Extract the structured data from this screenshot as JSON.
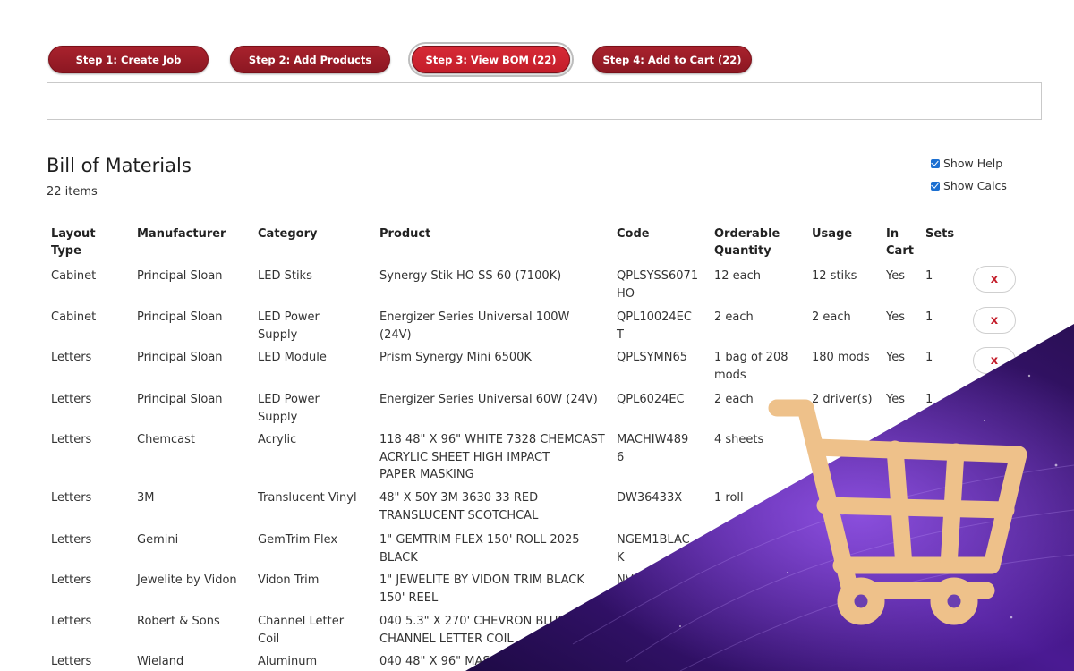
{
  "steps": [
    {
      "label": "Step 1: Create Job",
      "active": false
    },
    {
      "label": "Step 2: Add Products",
      "active": false
    },
    {
      "label": "Step 3: View BOM (22)",
      "active": true
    },
    {
      "label": "Step 4: Add to Cart (22)",
      "active": false
    }
  ],
  "bom": {
    "title": "Bill of Materials",
    "count": "22 items",
    "show_help": {
      "label": "Show Help",
      "checked": true
    },
    "show_calcs": {
      "label": "Show Calcs",
      "checked": true
    }
  },
  "table": {
    "headers": {
      "layout_type": [
        "Layout",
        "Type"
      ],
      "manufacturer": "Manufacturer",
      "category": "Category",
      "product": "Product",
      "code": "Code",
      "orderable_quantity": [
        "Orderable",
        "Quantity"
      ],
      "usage": "Usage",
      "in_cart": [
        "In",
        "Cart"
      ],
      "sets": "Sets"
    },
    "remove_label": "x",
    "rows": [
      {
        "layout": "Cabinet",
        "manufacturer": "Principal Sloan",
        "category": [
          "LED Stiks"
        ],
        "product": [
          "Synergy Stik HO SS 60 (7100K)"
        ],
        "code": [
          "QPLSYSS6071",
          "HO"
        ],
        "qty": [
          "12 each"
        ],
        "usage": "12 stiks",
        "in_cart": "Yes",
        "sets": "1"
      },
      {
        "layout": "Cabinet",
        "manufacturer": "Principal Sloan",
        "category": [
          "LED Power",
          "Supply"
        ],
        "product": [
          "Energizer Series Universal 100W",
          "(24V)"
        ],
        "code": [
          "QPL10024EC",
          "T"
        ],
        "qty": [
          "2 each"
        ],
        "usage": "2 each",
        "in_cart": "Yes",
        "sets": "1"
      },
      {
        "layout": "Letters",
        "manufacturer": "Principal Sloan",
        "category": [
          "LED Module"
        ],
        "product": [
          "Prism Synergy Mini 6500K"
        ],
        "code": [
          "QPLSYMN65"
        ],
        "qty": [
          "1 bag of 208",
          "mods"
        ],
        "usage": "180 mods",
        "in_cart": "Yes",
        "sets": "1"
      },
      {
        "layout": "Letters",
        "manufacturer": "Principal Sloan",
        "category": [
          "LED Power",
          "Supply"
        ],
        "product": [
          "Energizer Series Universal 60W (24V)"
        ],
        "code": [
          "QPL6024EC"
        ],
        "qty": [
          "2 each"
        ],
        "usage": "2 driver(s)",
        "in_cart": "Yes",
        "sets": "1"
      },
      {
        "layout": "Letters",
        "manufacturer": "Chemcast",
        "category": [
          "Acrylic"
        ],
        "product": [
          "118 48\" X 96\" WHITE 7328 CHEMCAST",
          "ACRYLIC SHEET HIGH IMPACT",
          "PAPER MASKING"
        ],
        "code": [
          "MACHIW489",
          "6"
        ],
        "qty": [
          "4 sheets"
        ],
        "usage": "",
        "in_cart": "",
        "sets": ""
      },
      {
        "layout": "Letters",
        "manufacturer": "3M",
        "category": [
          "Translucent Vinyl"
        ],
        "product": [
          "48\" X 50Y 3M 3630 33 RED",
          "TRANSLUCENT SCOTCHCAL"
        ],
        "code": [
          "DW36433X"
        ],
        "qty": [
          "1 roll"
        ],
        "usage": "",
        "in_cart": "",
        "sets": ""
      },
      {
        "layout": "Letters",
        "manufacturer": "Gemini",
        "category": [
          "GemTrim Flex"
        ],
        "product": [
          "1\" GEMTRIM FLEX 150' ROLL 2025",
          "BLACK"
        ],
        "code": [
          "NGEM1BLAC",
          "K"
        ],
        "qty": [
          ""
        ],
        "usage": "",
        "in_cart": "",
        "sets": ""
      },
      {
        "layout": "Letters",
        "manufacturer": "Jewelite by Vidon",
        "category": [
          "Vidon Trim"
        ],
        "product": [
          "1\" JEWELITE BY VIDON TRIM BLACK",
          "150' REEL"
        ],
        "code": [
          "NV"
        ],
        "qty": [
          ""
        ],
        "usage": "",
        "in_cart": "",
        "sets": ""
      },
      {
        "layout": "Letters",
        "manufacturer": "Robert & Sons",
        "category": [
          "Channel Letter",
          "Coil"
        ],
        "product": [
          "040 5.3\" X 270' CHEVRON BLUE",
          "CHANNEL LETTER COIL"
        ],
        "code": [
          ""
        ],
        "qty": [
          ""
        ],
        "usage": "",
        "in_cart": "",
        "sets": ""
      },
      {
        "layout": "Letters",
        "manufacturer": "Wieland",
        "category": [
          "Aluminum"
        ],
        "product": [
          "040 48\" X 96\" MAS"
        ],
        "code": [
          ""
        ],
        "qty": [
          ""
        ],
        "usage": "",
        "in_cart": "",
        "sets": ""
      }
    ]
  },
  "decor": {
    "cart_icon": "shopping-cart-icon",
    "cart_color": "#eec18a",
    "banner_colors": [
      "#2a0f55",
      "#5b21a8",
      "#8a4be0"
    ]
  }
}
